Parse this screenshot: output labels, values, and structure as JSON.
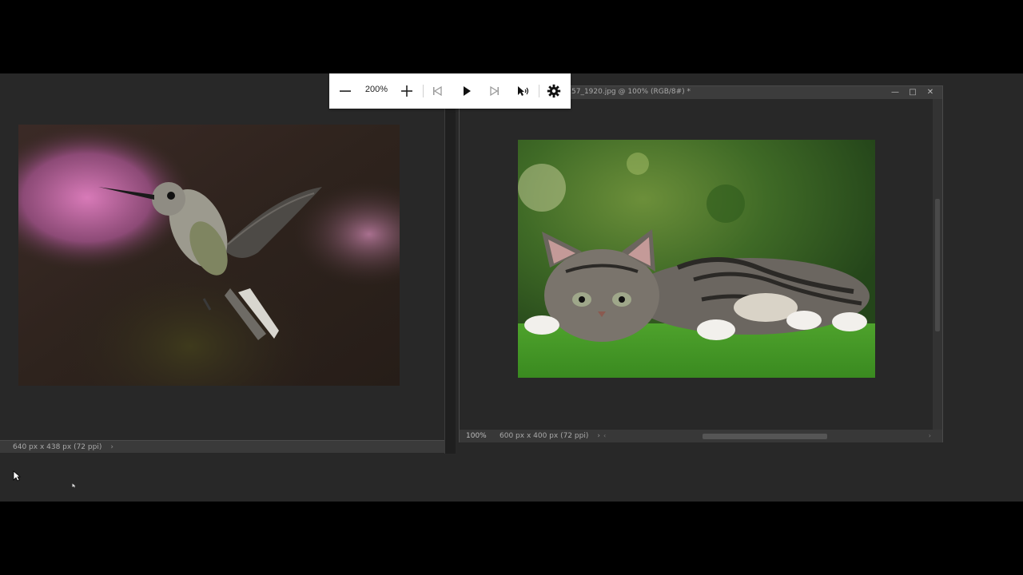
{
  "toolbar": {
    "zoom_level": "200%",
    "buttons": [
      "zoom-out",
      "zoom-in",
      "skip-back",
      "play",
      "skip-forward",
      "speed",
      "settings"
    ]
  },
  "left_document": {
    "status_text": "640 px x 438 px (72 ppi)",
    "status_arrow": "›"
  },
  "right_document": {
    "tab_title": "57_1920.jpg @ 100% (RGB/8#) *",
    "zoom_readout": "100%",
    "status_text": "600 px x 400 px (72 ppi)",
    "status_arrow": "›",
    "window_controls": {
      "minimize": "—",
      "restore": "□",
      "close": "✕"
    }
  },
  "images": {
    "left": "hummingbird",
    "right": "tabby-kitten"
  },
  "colors": {
    "app_background": "#282828",
    "toolbar_background": "#ffffff",
    "letterbox": "#000000"
  }
}
